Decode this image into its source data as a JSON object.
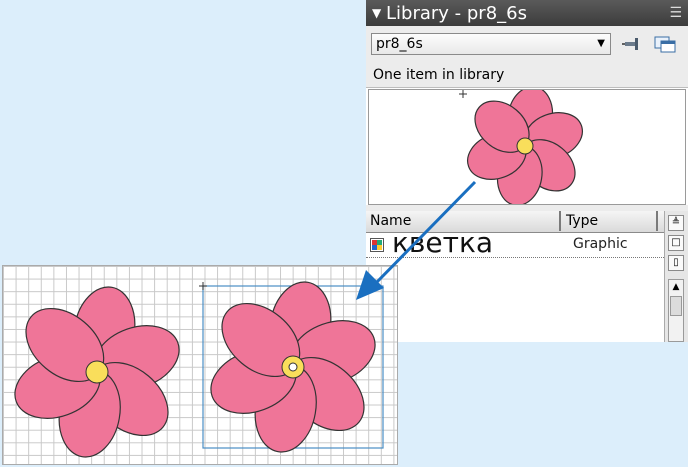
{
  "library": {
    "title": "Library - pr8_6s",
    "selected_library": "pr8_6s",
    "item_count": "One item in library",
    "columns": {
      "name": "Name",
      "type": "Type"
    },
    "items": [
      {
        "name": "кветка",
        "type": "Graphic"
      }
    ]
  },
  "colors": {
    "petal": "#ef7598",
    "center": "#f9de5b",
    "accent_arrow": "#1a6fc0",
    "selection": "#4a8ec4"
  },
  "icons": [
    "collapse-triangle-icon",
    "panel-menu-icon",
    "dropdown-arrow-icon",
    "pin-icon",
    "new-library-panel-icon",
    "graphic-symbol-icon",
    "sort-icon",
    "wide-view-icon",
    "narrow-view-icon",
    "scroll-up-icon"
  ]
}
